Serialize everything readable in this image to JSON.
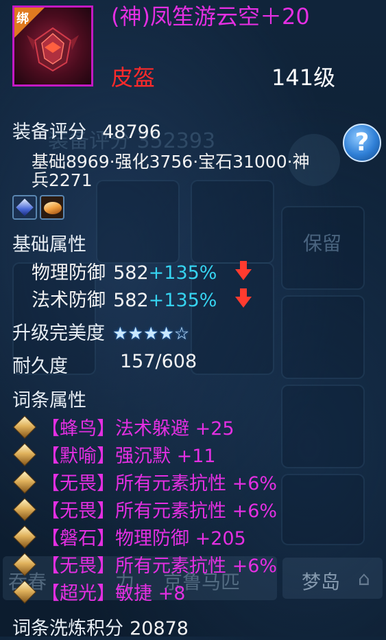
{
  "item": {
    "bind_badge": "绑",
    "name": "(神)凤笙游云空＋20",
    "type": "皮盔",
    "level": "141级"
  },
  "score": {
    "label": "装备评分",
    "value": "48796",
    "bg_text": "装备评分 352393",
    "breakdown": "基础8969·强化3756·宝石31000·神兵2271"
  },
  "base_attrs": {
    "title": "基础属性",
    "items": [
      {
        "name": "物理防御",
        "value": "582",
        "bonus": "+135%"
      },
      {
        "name": "法术防御",
        "value": "582",
        "bonus": "+135%"
      }
    ]
  },
  "upgrade": {
    "label": "升级完美度",
    "stars_filled": 4,
    "stars_total": 5
  },
  "durability": {
    "label": "耐久度",
    "value": "157/608"
  },
  "affixes": {
    "title": "词条属性",
    "items": [
      {
        "tag": "【蜂鸟】",
        "text": "法术躲避 +25"
      },
      {
        "tag": "【默喻】",
        "text": "强沉默 +11"
      },
      {
        "tag": "【无畏】",
        "text": "所有元素抗性 +6%"
      },
      {
        "tag": "【无畏】",
        "text": "所有元素抗性 +6%"
      },
      {
        "tag": "【磐石】",
        "text": "物理防御 +205"
      },
      {
        "tag": "【无畏】",
        "text": "所有元素抗性 +6%"
      },
      {
        "tag": "【超光】",
        "text": "敏捷 +8"
      }
    ]
  },
  "refine": {
    "label": "词条洗炼积分",
    "value": "20878"
  },
  "background_ui": {
    "reserve_button": "保留",
    "tabs": [
      "吞春",
      "力",
      "京鲁马匹",
      "梦岛"
    ]
  },
  "colors": {
    "affix": "#e42fe2",
    "bonus": "#36d3f0",
    "down_arrow": "#ff3b2f"
  }
}
